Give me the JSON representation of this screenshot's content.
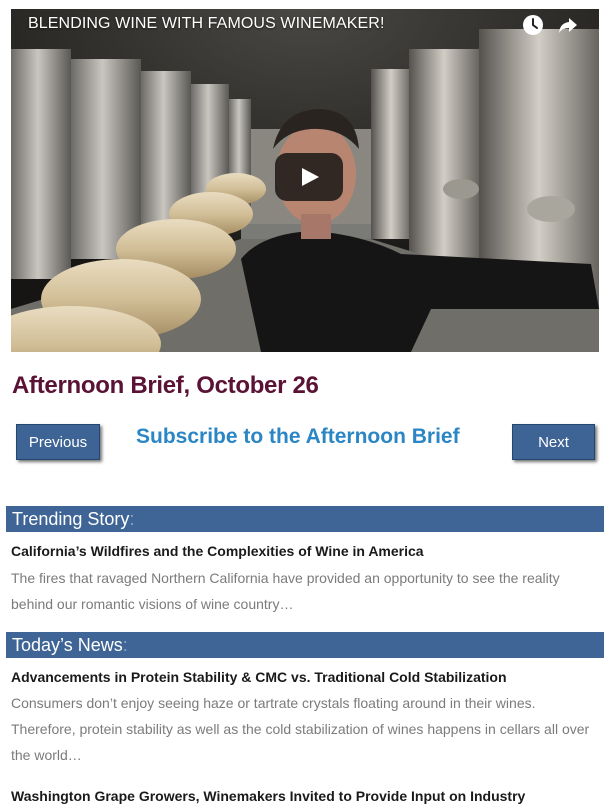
{
  "video": {
    "title": "BLENDING WINE WITH FAMOUS WINEMAKER!",
    "icons": [
      "clock-icon",
      "share-icon",
      "play-icon"
    ]
  },
  "page": {
    "title": "Afternoon Brief, October 26"
  },
  "nav": {
    "previous_label": "Previous",
    "subscribe_label": "Subscribe to the Afternoon Brief",
    "next_label": "Next"
  },
  "sections": {
    "trending": {
      "heading": "Trending Story",
      "colon": ":",
      "story": {
        "headline": "California’s Wildfires and the Complexities of Wine in America",
        "summary": "The fires that ravaged Northern California have provided an opportunity to see the reality behind our romantic visions of wine country…"
      }
    },
    "news": {
      "heading": "Today’s News",
      "colon": ":",
      "stories": [
        {
          "headline": "Advancements in Protein Stability & CMC vs. Traditional Cold Stabilization",
          "summary": "Consumers don’t enjoy seeing haze or tartrate crystals floating around in their wines. Therefore, protein stability as well as the cold stabilization of wines happens in cellars all over the world…"
        },
        {
          "headline": "Washington Grape Growers, Winemakers Invited to Provide Input on Industry"
        }
      ]
    }
  },
  "colors": {
    "title": "#5a1235",
    "button_bg": "#3d6495",
    "subscribe_link": "#2a86c4",
    "section_bar": "#3e6595",
    "summary_text": "#7b7b7b"
  }
}
